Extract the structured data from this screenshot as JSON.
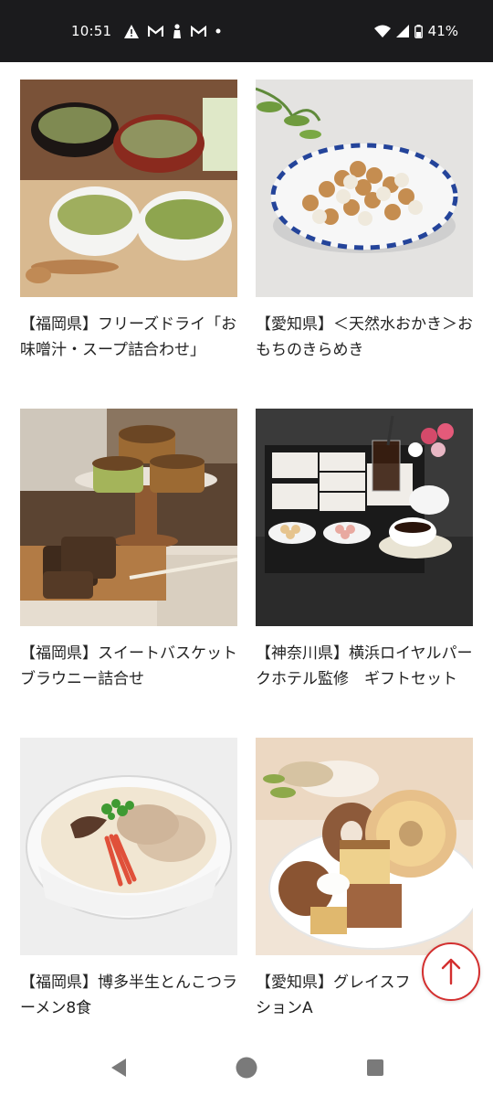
{
  "status_bar": {
    "time": "10:51",
    "battery": "41%",
    "notification_icons": [
      "warning-icon",
      "gmail-icon",
      "person-icon",
      "gmail-icon",
      "dot-icon"
    ],
    "system_icons": [
      "wifi-icon",
      "signal-icon",
      "battery-icon"
    ]
  },
  "products": [
    {
      "title": "【福岡県】フリーズドライ「お味噌汁・スープ詰合わせ」",
      "image": "miso-soup-bowls"
    },
    {
      "title": "【愛知県】＜天然水おかき＞おもちのきらめき",
      "image": "rice-crackers-plate"
    },
    {
      "title": "【福岡県】スイートバスケット ブラウニー詰合せ",
      "image": "brownies-cake-stand"
    },
    {
      "title": "【神奈川県】横浜ロイヤルパークホテル監修　ギフトセット",
      "image": "hotel-gift-set"
    },
    {
      "title": "【福岡県】博多半生とんこつラーメン8食",
      "image": "tonkotsu-ramen-bowl"
    },
    {
      "title": "【愛知県】グレイスフ　セレクションA",
      "image": "baumkuchen-plate"
    }
  ],
  "scroll_top_button": {
    "icon": "arrow-up-icon",
    "color": "#d32f2f"
  },
  "nav_bar": {
    "buttons": [
      "back-icon",
      "home-icon",
      "recents-icon"
    ]
  }
}
